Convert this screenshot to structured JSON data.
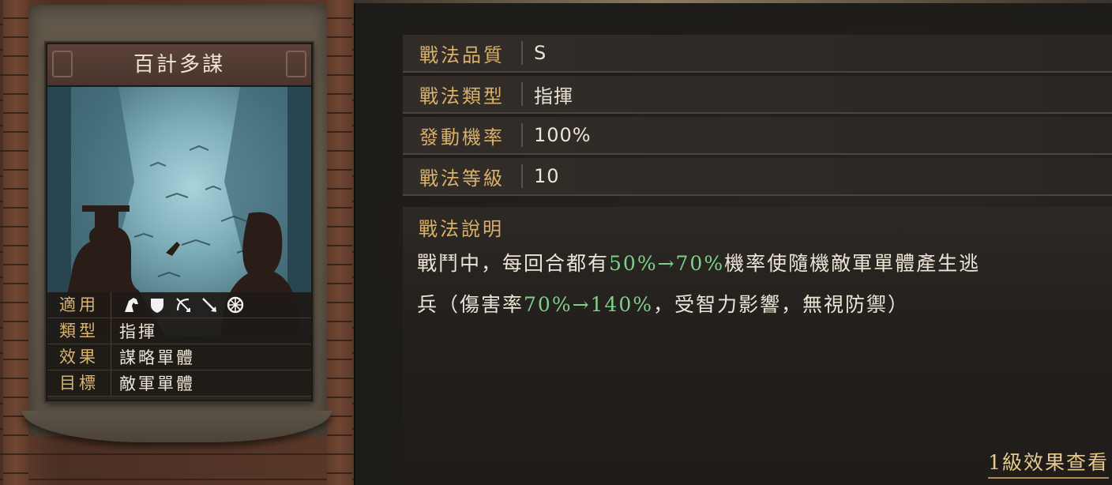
{
  "card": {
    "title": "百計多謀",
    "rows": [
      {
        "key": "適用",
        "value": ""
      },
      {
        "key": "類型",
        "value": "指揮"
      },
      {
        "key": "效果",
        "value": "謀略單體"
      },
      {
        "key": "目標",
        "value": "敵軍單體"
      }
    ],
    "unit_icons": [
      "cavalry-icon",
      "shield-icon",
      "archer-icon",
      "spear-icon",
      "wheel-icon"
    ]
  },
  "info": {
    "rows": [
      {
        "key": "戰法品質",
        "value": "S"
      },
      {
        "key": "戰法類型",
        "value": "指揮"
      },
      {
        "key": "發動機率",
        "value": "100%"
      },
      {
        "key": "戰法等級",
        "value": "10"
      }
    ]
  },
  "description": {
    "title": "戰法說明",
    "line1_a": "戰鬥中，每回合都有",
    "line1_hl": "50%→70%",
    "line1_b": "機率使隨機敵軍單體產生逃",
    "line2_a": "兵（傷害率",
    "line2_hl": "70%→140%",
    "line2_b": "，受智力影響，無視防禦）"
  },
  "link": {
    "label": "1級效果查看"
  },
  "colors": {
    "highlight": "#7fd08a",
    "gold_label": "#d8b06a"
  }
}
